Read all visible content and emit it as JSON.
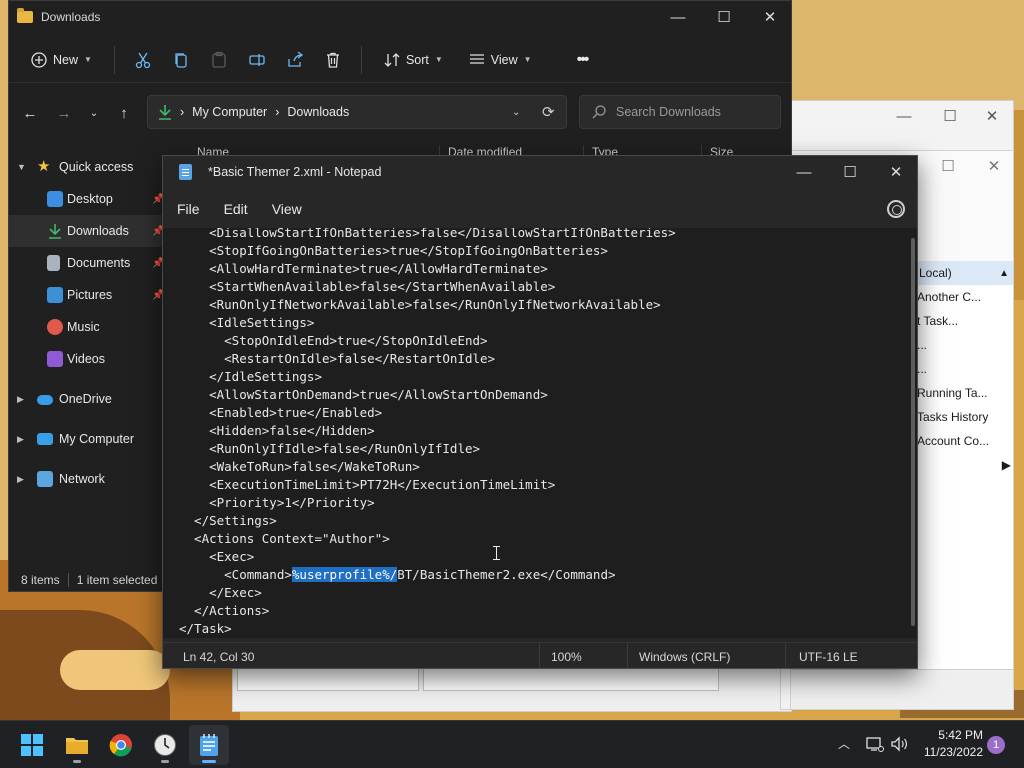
{
  "explorer": {
    "title": "Downloads",
    "toolbar": {
      "new_label": "New",
      "sort_label": "Sort",
      "view_label": "View",
      "more_label": "•••"
    },
    "breadcrumb": [
      "My Computer",
      "Downloads"
    ],
    "search_placeholder": "Search Downloads",
    "columns": [
      "Name",
      "Date modified",
      "Type",
      "Size"
    ],
    "nav": [
      {
        "label": "Quick access"
      },
      {
        "label": "Desktop"
      },
      {
        "label": "Downloads"
      },
      {
        "label": "Documents"
      },
      {
        "label": "Pictures"
      },
      {
        "label": "Music"
      },
      {
        "label": "Videos"
      },
      {
        "label": "OneDrive"
      },
      {
        "label": "My Computer"
      },
      {
        "label": "Network"
      }
    ],
    "status": {
      "items": "8 items",
      "selected": "1 item selected"
    }
  },
  "notepad": {
    "title": "*Basic Themer 2.xml - Notepad",
    "menu": [
      "File",
      "Edit",
      "View"
    ],
    "lines": [
      "    <DisallowStartIfOnBatteries>false</DisallowStartIfOnBatteries>",
      "    <StopIfGoingOnBatteries>true</StopIfGoingOnBatteries>",
      "    <AllowHardTerminate>true</AllowHardTerminate>",
      "    <StartWhenAvailable>false</StartWhenAvailable>",
      "    <RunOnlyIfNetworkAvailable>false</RunOnlyIfNetworkAvailable>",
      "    <IdleSettings>",
      "      <StopOnIdleEnd>true</StopOnIdleEnd>",
      "      <RestartOnIdle>false</RestartOnIdle>",
      "    </IdleSettings>",
      "    <AllowStartOnDemand>true</AllowStartOnDemand>",
      "    <Enabled>true</Enabled>",
      "    <Hidden>false</Hidden>",
      "    <RunOnlyIfIdle>false</RunOnlyIfIdle>",
      "    <WakeToRun>false</WakeToRun>",
      "    <ExecutionTimeLimit>PT72H</ExecutionTimeLimit>",
      "    <Priority>1</Priority>",
      "  </Settings>",
      "  <Actions Context=\"Author\">",
      "    <Exec>",
      "      <Command>%userprofile%/BT/BasicThemer2.exe</Command>",
      "    </Exec>",
      "  </Actions>",
      "</Task>"
    ],
    "command_line": {
      "prefix": "      <Command>",
      "selected": "%userprofile%/",
      "suffix": "BT/BasicThemer2.exe</Command>"
    },
    "status": {
      "position": "Ln 42, Col 30",
      "zoom": "100%",
      "line_ending": "Windows (CRLF)",
      "encoding": "UTF-16 LE"
    }
  },
  "background_window": {
    "actions_header": "Local)",
    "actions": [
      "Another C...",
      "t Task...",
      "...",
      "...",
      "Running Ta...",
      "Tasks History",
      "Account Co..."
    ]
  },
  "taskbar": {
    "time": "5:42 PM",
    "date": "11/23/2022",
    "notification_count": "1",
    "apps": [
      "start",
      "file-explorer",
      "chrome",
      "clock",
      "notepad"
    ]
  },
  "colors": {
    "selection": "#1f6fc5",
    "notepad_bg": "#1e1e1e",
    "taskbar": "#1f2124",
    "accent": "#4cc2ff"
  }
}
